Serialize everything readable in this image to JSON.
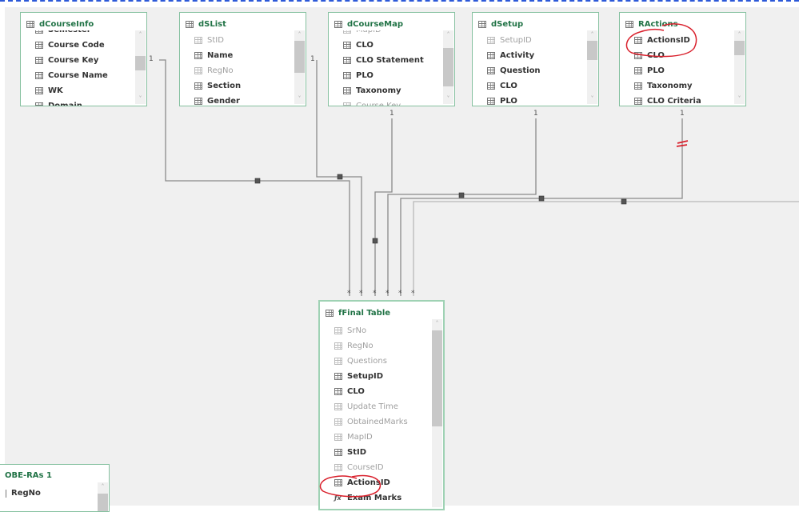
{
  "tables": {
    "dCourseInfo": {
      "name": "dCourseInfo",
      "fields": [
        {
          "label": "Semester",
          "hidden": false
        },
        {
          "label": "Course Code",
          "hidden": false
        },
        {
          "label": "Course Key",
          "hidden": false
        },
        {
          "label": "Course Name",
          "hidden": false
        },
        {
          "label": "WK",
          "hidden": false
        },
        {
          "label": "Domain",
          "hidden": false
        }
      ]
    },
    "dSList": {
      "name": "dSList",
      "fields": [
        {
          "label": "StID",
          "hidden": true
        },
        {
          "label": "Name",
          "hidden": false
        },
        {
          "label": "RegNo",
          "hidden": true
        },
        {
          "label": "Section",
          "hidden": false
        },
        {
          "label": "Gender",
          "hidden": false
        }
      ]
    },
    "dCourseMap": {
      "name": "dCourseMap",
      "fields": [
        {
          "label": "MapID",
          "hidden": true
        },
        {
          "label": "CLO",
          "hidden": false
        },
        {
          "label": "CLO Statement",
          "hidden": false
        },
        {
          "label": "PLO",
          "hidden": false
        },
        {
          "label": "Taxonomy",
          "hidden": false
        },
        {
          "label": "Course Key",
          "hidden": true
        }
      ]
    },
    "dSetup": {
      "name": "dSetup",
      "fields": [
        {
          "label": "SetupID",
          "hidden": true
        },
        {
          "label": "Activity",
          "hidden": false
        },
        {
          "label": "Question",
          "hidden": false
        },
        {
          "label": "CLO",
          "hidden": false
        },
        {
          "label": "PLO",
          "hidden": false
        }
      ]
    },
    "RActions": {
      "name": "RActions",
      "fields": [
        {
          "label": "ActionsID",
          "hidden": false
        },
        {
          "label": "CLO",
          "hidden": false
        },
        {
          "label": "PLO",
          "hidden": false
        },
        {
          "label": "Taxonomy",
          "hidden": false
        },
        {
          "label": "CLO Criteria",
          "hidden": false
        }
      ]
    },
    "fFinal": {
      "name": "fFinal Table",
      "fields": [
        {
          "label": "SrNo",
          "hidden": true
        },
        {
          "label": "RegNo",
          "hidden": true
        },
        {
          "label": "Questions",
          "hidden": true
        },
        {
          "label": "SetupID",
          "hidden": false
        },
        {
          "label": "CLO",
          "hidden": false
        },
        {
          "label": "Update Time",
          "hidden": true
        },
        {
          "label": "ObtainedMarks",
          "hidden": true
        },
        {
          "label": "MapID",
          "hidden": true
        },
        {
          "label": "StID",
          "hidden": false
        },
        {
          "label": "CourseID",
          "hidden": true
        },
        {
          "label": "ActionsID",
          "hidden": false
        },
        {
          "label": "Exam Marks",
          "hidden": false,
          "measure": true
        }
      ]
    },
    "OBERAs": {
      "name": "OBE-RAs 1",
      "fields": [
        {
          "label": "RegNo",
          "hidden": false
        }
      ]
    }
  },
  "relationships": {
    "one_label": "1",
    "many_label": "*"
  },
  "colors": {
    "table_title": "#217346",
    "table_border": "#86c1a0",
    "annotation": "#d9202c",
    "line": "#8a8a8a"
  }
}
